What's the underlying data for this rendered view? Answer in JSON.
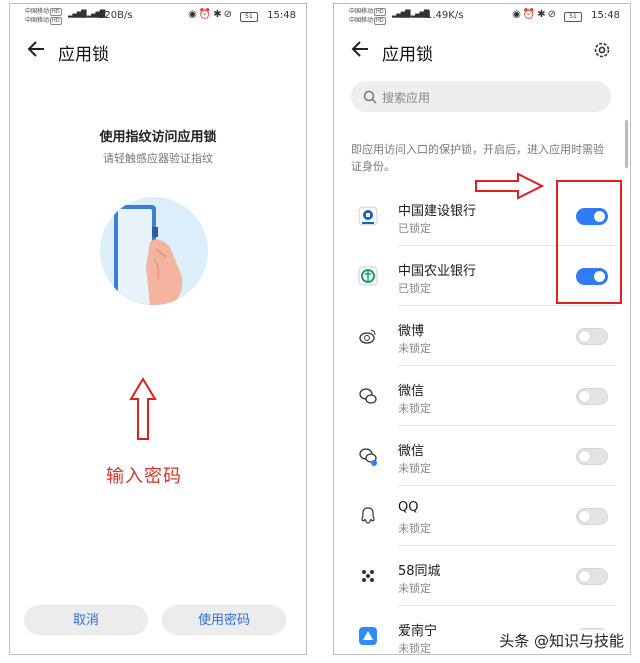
{
  "left_screen": {
    "status": {
      "carrier_line1": "中国移动",
      "carrier_line2": "中国移动",
      "hd": "HD",
      "speed": "120B/s",
      "battery": "51",
      "time": "15:48"
    },
    "title": "应用锁",
    "fingerprint_title": "使用指纹访问应用锁",
    "fingerprint_sub": "请轻触感应器验证指纹",
    "annotation": "输入密码",
    "buttons": {
      "cancel": "取消",
      "use_password": "使用密码"
    }
  },
  "right_screen": {
    "status": {
      "carrier_line1": "中国移动",
      "carrier_line2": "中国移动",
      "hd": "HD",
      "speed": "1.49K/s",
      "battery": "51",
      "time": "15:48"
    },
    "title": "应用锁",
    "search_placeholder": "搜索应用",
    "description": "即应用访问入口的保护锁，开启后，进入应用时需验证身份。",
    "apps": [
      {
        "name": "中国建设银行",
        "status": "已锁定",
        "locked": true,
        "icon": "ccb-icon"
      },
      {
        "name": "中国农业银行",
        "status": "已锁定",
        "locked": true,
        "icon": "abc-bank-icon"
      },
      {
        "name": "微博",
        "status": "未锁定",
        "locked": false,
        "icon": "weibo-icon"
      },
      {
        "name": "微信",
        "status": "未锁定",
        "locked": false,
        "icon": "wechat-icon"
      },
      {
        "name": "微信",
        "status": "未锁定",
        "locked": false,
        "icon": "wechat-clone-icon"
      },
      {
        "name": "QQ",
        "status": "未锁定",
        "locked": false,
        "icon": "qq-icon"
      },
      {
        "name": "58同城",
        "status": "未锁定",
        "locked": false,
        "icon": "58-icon"
      },
      {
        "name": "爱南宁",
        "status": "未锁定",
        "locked": false,
        "icon": "ainanning-icon"
      }
    ]
  },
  "watermark": "头条 @知识与技能",
  "colors": {
    "accent": "#2f7cf6",
    "annotation_red": "#e02020",
    "button_text": "#2f6fe0"
  }
}
